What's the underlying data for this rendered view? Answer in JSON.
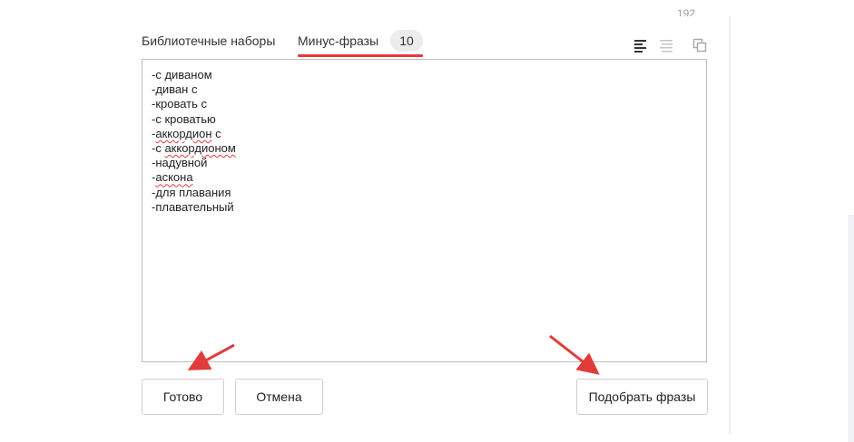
{
  "header": {
    "count_partial": "192"
  },
  "tabs": [
    {
      "label": "Библиотечные наборы",
      "active": false
    },
    {
      "label": "Минус-фразы",
      "active": true,
      "badge": "10"
    }
  ],
  "toolbar_icons": [
    "align-left-icon",
    "list-icon",
    "copy-icon"
  ],
  "editor": {
    "lines": [
      {
        "prefix": "-с диваном"
      },
      {
        "prefix": "-диван с"
      },
      {
        "prefix": "-кровать с"
      },
      {
        "prefix": "-с кроватью"
      },
      {
        "prefix": "-",
        "misspelled": "аккордион",
        "suffix": " с"
      },
      {
        "prefix": "-с ",
        "misspelled": "аккордионом"
      },
      {
        "prefix": "-надувной"
      },
      {
        "prefix": "-",
        "misspelled": "аскона"
      },
      {
        "prefix": "-для плавания"
      },
      {
        "prefix": "-плавательный"
      }
    ]
  },
  "buttons": {
    "done": "Готово",
    "cancel": "Отмена",
    "pick_phrases": "Подобрать фразы"
  },
  "colors": {
    "accent": "#e23b3b",
    "badge_bg": "#ececec",
    "border": "#bdbdbd"
  }
}
